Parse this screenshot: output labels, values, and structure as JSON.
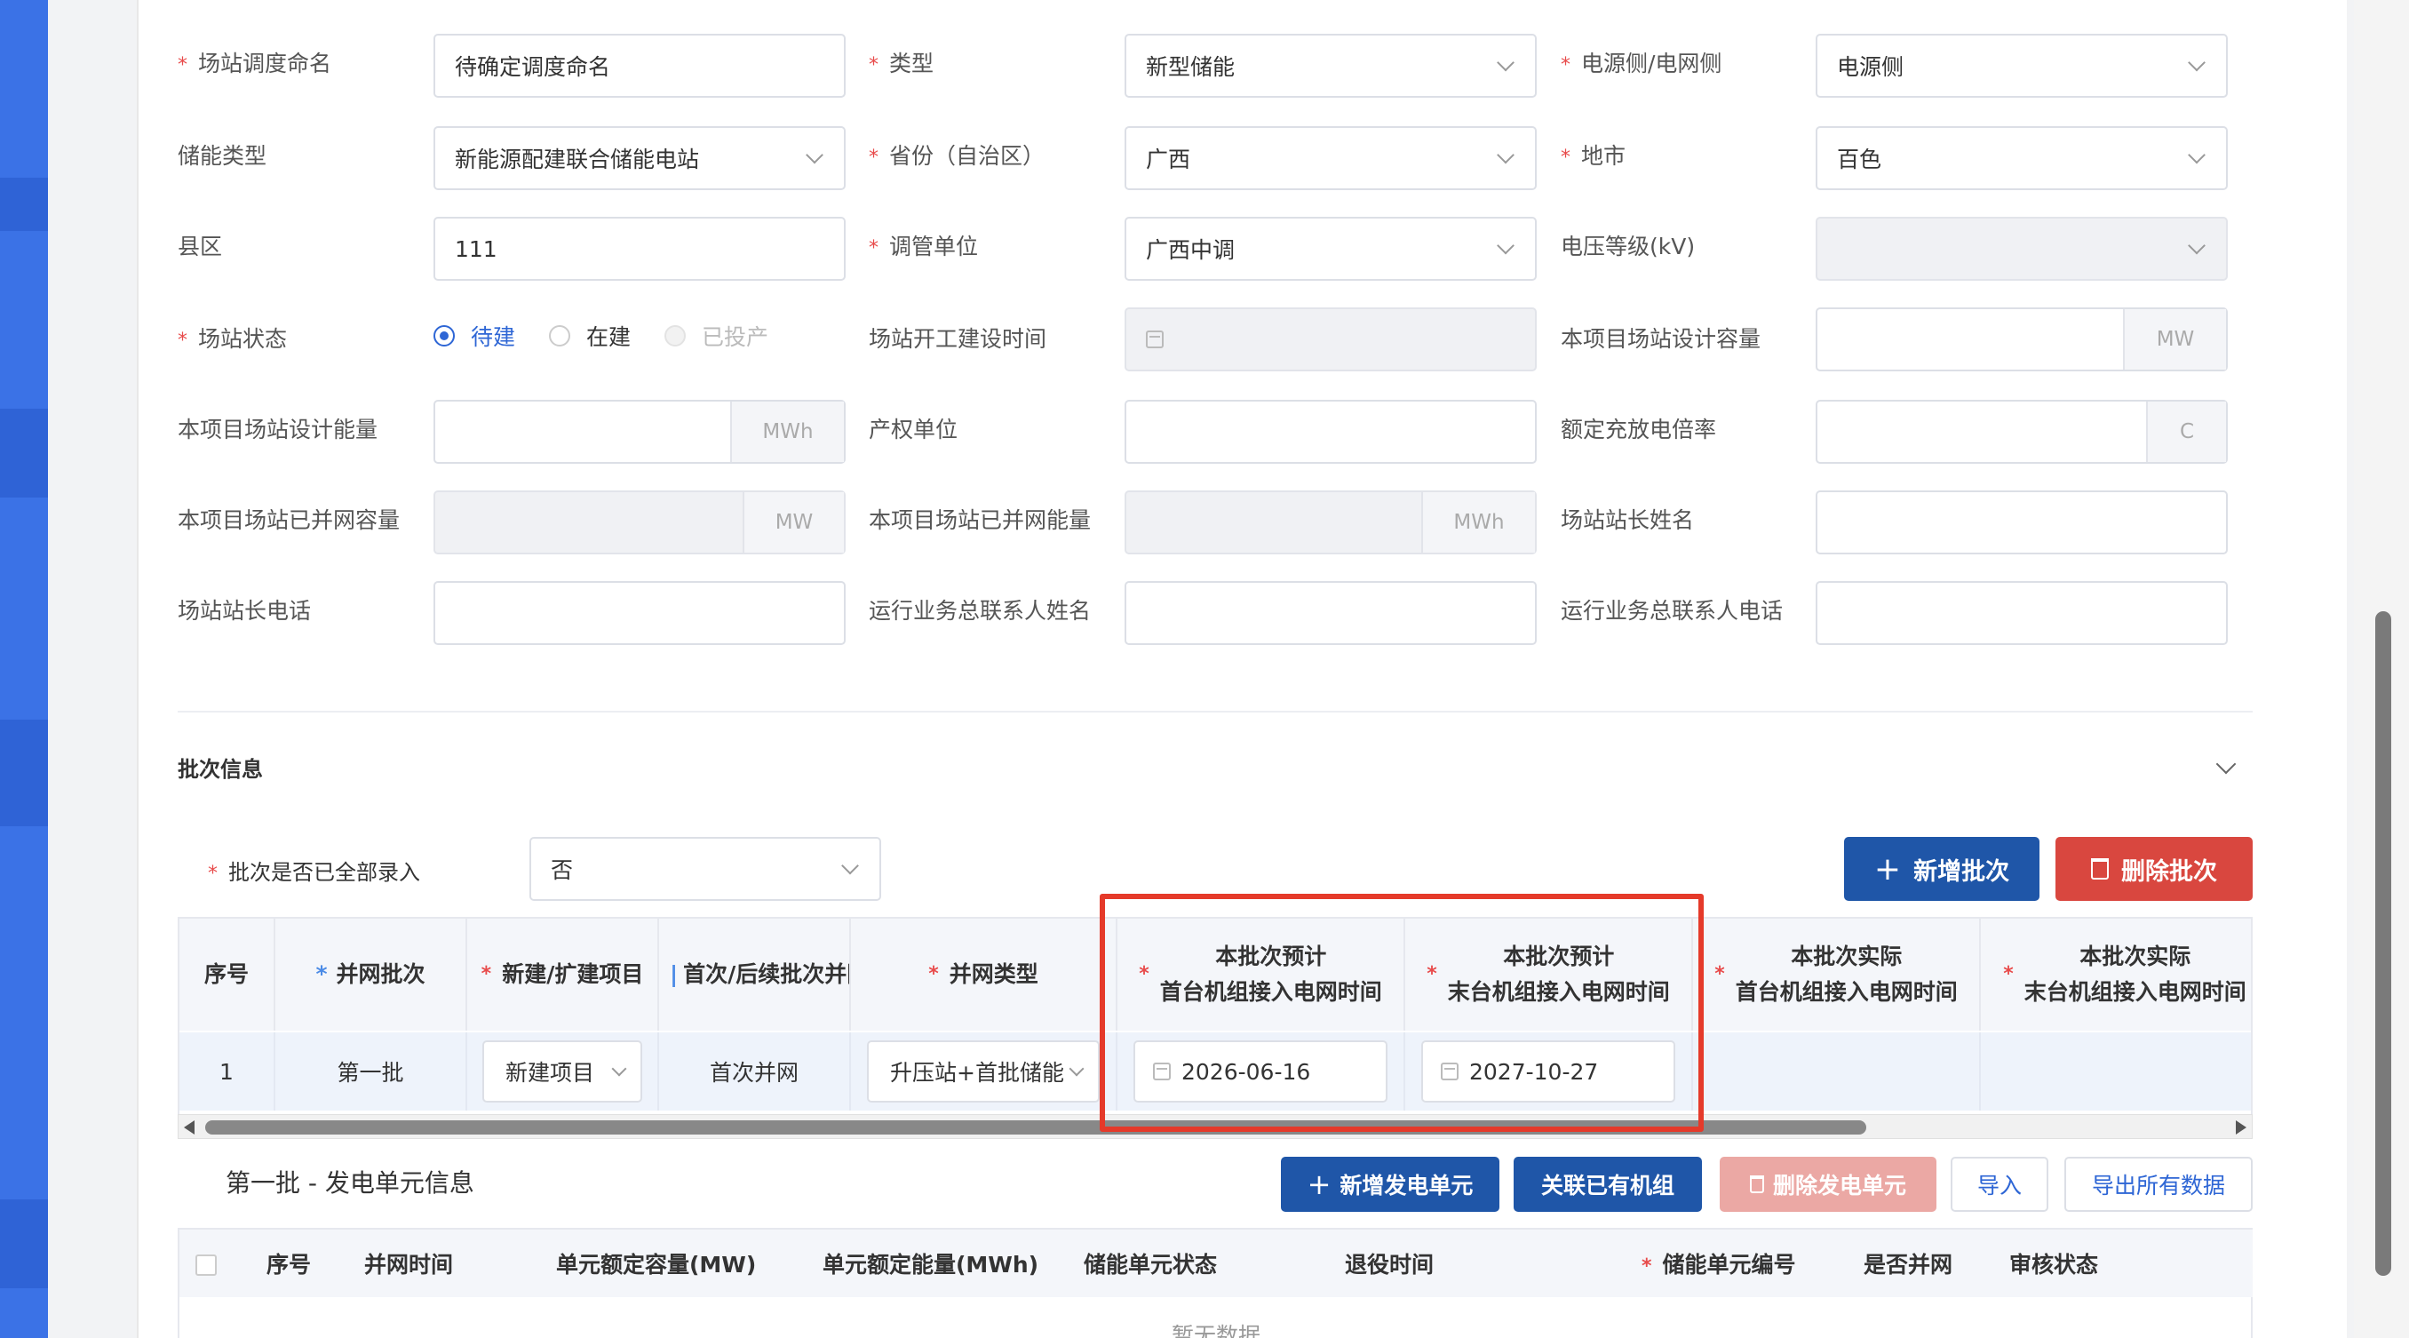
{
  "form": {
    "name_label": "场站调度命名",
    "name_value": "待确定调度命名",
    "type_label": "类型",
    "type_value": "新型储能",
    "side_label": "电源侧/电网侧",
    "side_value": "电源侧",
    "storage_type_label": "储能类型",
    "storage_type_value": "新能源配建联合储能电站",
    "province_label": "省份（自治区）",
    "province_value": "广西",
    "city_label": "地市",
    "city_value": "百色",
    "county_label": "县区",
    "county_value": "111",
    "dispatch_label": "调管单位",
    "dispatch_value": "广西中调",
    "voltage_label": "电压等级(kV)",
    "voltage_value": "",
    "status_label": "场站状态",
    "status_options": [
      "待建",
      "在建",
      "已投产"
    ],
    "start_time_label": "场站开工建设时间",
    "design_capacity_label": "本项目场站设计容量",
    "design_capacity_unit": "MW",
    "design_energy_label": "本项目场站设计能量",
    "design_energy_unit": "MWh",
    "owner_label": "产权单位",
    "rate_label": "额定充放电倍率",
    "rate_unit": "C",
    "grid_capacity_label": "本项目场站已并网容量",
    "grid_capacity_unit": "MW",
    "grid_energy_label": "本项目场站已并网能量",
    "grid_energy_unit": "MWh",
    "manager_name_label": "场站站长姓名",
    "manager_phone_label": "场站站长电话",
    "ops_name_label": "运行业务总联系人姓名",
    "ops_phone_label": "运行业务总联系人电话"
  },
  "batch": {
    "section_title": "批次信息",
    "all_entered_label": "批次是否已全部录入",
    "all_entered_value": "否",
    "add_button": "新增批次",
    "delete_button": "删除批次",
    "columns": [
      "序号",
      "并网批次",
      "新建/扩建项目",
      "首次/后续批次并网",
      "并网类型",
      "本批次预计\n首台机组接入电网时间",
      "本批次预计\n末台机组接入电网时间",
      "本批次实际\n首台机组接入电网时间",
      "本批次实际\n末台机组接入电网时间"
    ],
    "row": {
      "index": "1",
      "batch": "第一批",
      "project": "新建项目",
      "first_or_later": "首次并网",
      "grid_type": "升压站+首批储能",
      "planned_first": "2026-06-16",
      "planned_last": "2027-10-27"
    }
  },
  "units": {
    "title": "第一批 - 发电单元信息",
    "add_button": "新增发电单元",
    "link_button": "关联已有机组",
    "delete_button": "删除发电单元",
    "import_button": "导入",
    "export_button": "导出所有数据",
    "columns": [
      "序号",
      "并网时间",
      "单元额定容量(MW)",
      "单元额定能量(MWh)",
      "储能单元状态",
      "退役时间",
      "储能单元编号",
      "是否并网",
      "审核状态"
    ],
    "empty_text": "暂无数据"
  }
}
